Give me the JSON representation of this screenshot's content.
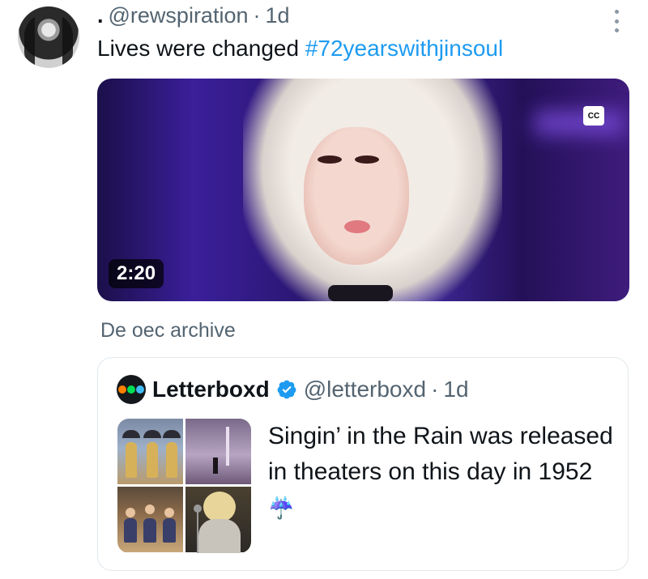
{
  "tweet": {
    "prefix": ".",
    "handle": "@rewspiration",
    "separator": "·",
    "time": "1d",
    "text_plain": "Lives were changed ",
    "hashtag": "#72yearswithjinsoul"
  },
  "video": {
    "duration": "2:20",
    "cc_label": "CC"
  },
  "context_label": "De oec archive",
  "quoted": {
    "name": "Letterboxd",
    "handle": "@letterboxd",
    "separator": "·",
    "time": "1d",
    "text": "Singin’ in the Rain was released in theaters on this day in 1952",
    "emoji": "☔"
  },
  "colors": {
    "link": "#1d9bf0",
    "muted": "#536471",
    "text": "#0f1419",
    "verified": "#1d9bf0",
    "letterboxd_orange": "#ff8000",
    "letterboxd_green": "#00e054",
    "letterboxd_blue": "#40bcf4"
  },
  "icons": {
    "more": "vertical-ellipsis-icon",
    "verified": "verified-badge-icon",
    "captions": "closed-captions-icon",
    "logo": "letterboxd-logo-icon"
  }
}
